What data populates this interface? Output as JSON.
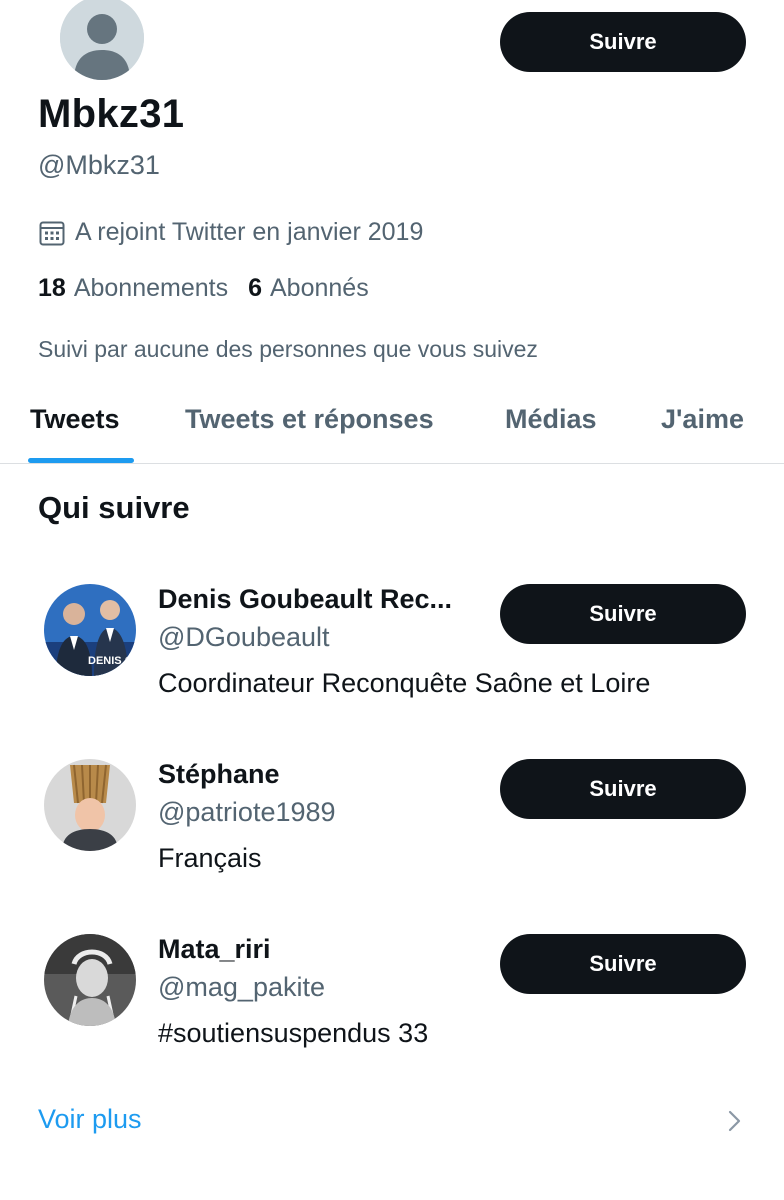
{
  "profile": {
    "name": "Mbkz31",
    "handle": "@Mbkz31",
    "joined": "A rejoint Twitter en janvier 2019",
    "following_count": "18",
    "following_label": "Abonnements",
    "followers_count": "6",
    "followers_label": "Abonnés",
    "followed_by": "Suivi par aucune des personnes que vous suivez",
    "follow_button": "Suivre"
  },
  "tabs": [
    {
      "label": "Tweets",
      "active": true
    },
    {
      "label": "Tweets et réponses",
      "active": false
    },
    {
      "label": "Médias",
      "active": false
    },
    {
      "label": "J'aime",
      "active": false
    }
  ],
  "who_to_follow": {
    "title": "Qui suivre",
    "items": [
      {
        "name": "Denis Goubeault Rec...",
        "handle": "@DGoubeault",
        "bio": "Coordinateur Reconquête Saône et Loire",
        "button": "Suivre",
        "avatar_text": "DENIS GOUBEAULT"
      },
      {
        "name": "Stéphane",
        "handle": "@patriote1989",
        "bio": "Français",
        "button": "Suivre"
      },
      {
        "name": "Mata_riri",
        "handle": "@mag_pakite",
        "bio": "#soutiensuspendus 33",
        "button": "Suivre"
      }
    ],
    "see_more": "Voir plus"
  },
  "icons": {
    "calendar": "calendar-icon",
    "chevron": "chevron-right-icon",
    "default_avatar": "default-avatar-icon"
  },
  "colors": {
    "accent": "#1d9bf0",
    "text": "#0f1419",
    "secondary": "#536471",
    "button": "#0f1419"
  }
}
